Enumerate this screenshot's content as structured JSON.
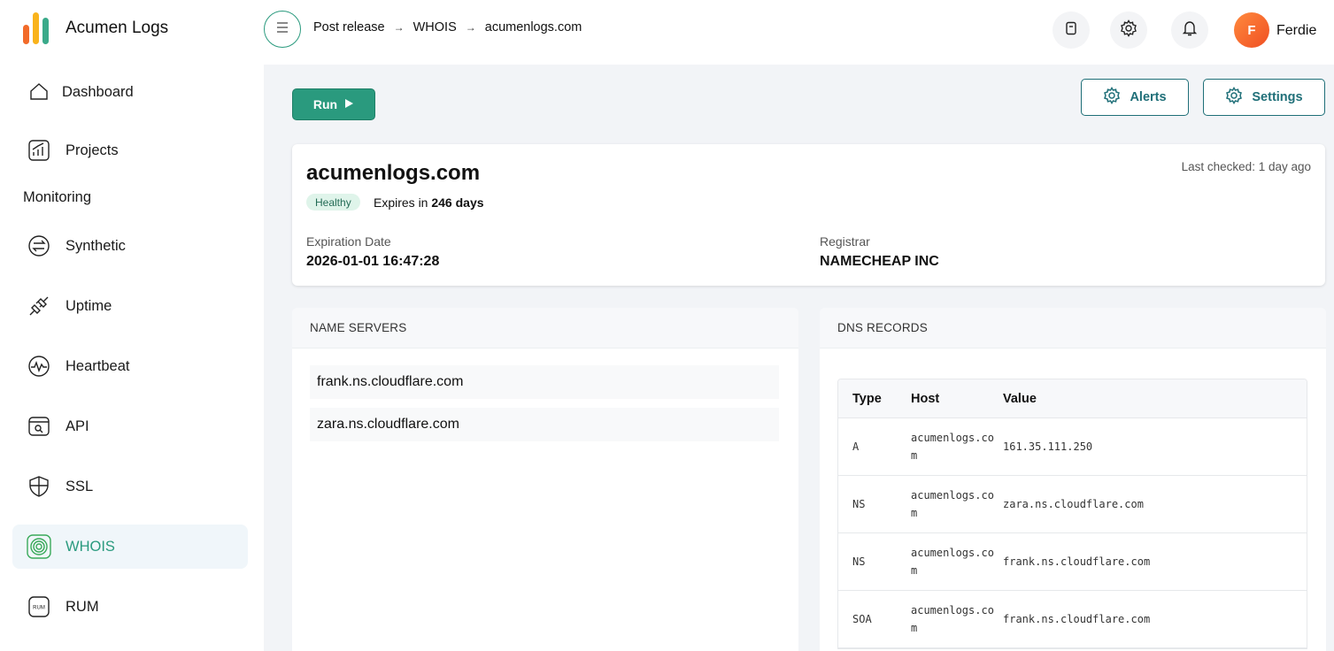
{
  "app": {
    "name": "Acumen Logs",
    "logo_colors": [
      "#f26b2a",
      "#f9b31c",
      "#3aaa8a"
    ]
  },
  "sidebar": {
    "items": [
      {
        "label": "Dashboard",
        "icon": "home-icon"
      },
      {
        "label": "Projects",
        "icon": "chart-icon"
      }
    ],
    "section_title": "Monitoring",
    "monitoring_items": [
      {
        "label": "Synthetic",
        "icon": "synthetic-icon"
      },
      {
        "label": "Uptime",
        "icon": "plug-icon"
      },
      {
        "label": "Heartbeat",
        "icon": "heartbeat-icon"
      },
      {
        "label": "API",
        "icon": "api-icon"
      },
      {
        "label": "SSL",
        "icon": "shield-icon"
      },
      {
        "label": "WHOIS",
        "icon": "whois-icon",
        "active": true
      },
      {
        "label": "RUM",
        "icon": "rum-icon",
        "icon_text": "RUM"
      }
    ]
  },
  "header": {
    "breadcrumb": [
      "Post release",
      "WHOIS",
      "acumenlogs.com"
    ],
    "user": {
      "initial": "F",
      "name": "Ferdie"
    }
  },
  "toolbar": {
    "run_label": "Run",
    "alerts_label": "Alerts",
    "settings_label": "Settings"
  },
  "summary": {
    "domain": "acumenlogs.com",
    "last_checked": "Last checked: 1 day ago",
    "status": "Healthy",
    "expires_prefix": "Expires in ",
    "expires_days": "246 days",
    "expiration_label": "Expiration Date",
    "expiration_value": "2026-01-01 16:47:28",
    "registrar_label": "Registrar",
    "registrar_value": "NAMECHEAP INC"
  },
  "name_servers": {
    "title": "NAME SERVERS",
    "items": [
      "frank.ns.cloudflare.com",
      "zara.ns.cloudflare.com"
    ]
  },
  "dns_records": {
    "title": "DNS RECORDS",
    "columns": [
      "Type",
      "Host",
      "Value"
    ],
    "rows": [
      {
        "type": "A",
        "host": "acumenlogs.com",
        "value": "161.35.111.250"
      },
      {
        "type": "NS",
        "host": "acumenlogs.com",
        "value": "zara.ns.cloudflare.com"
      },
      {
        "type": "NS",
        "host": "acumenlogs.com",
        "value": "frank.ns.cloudflare.com"
      },
      {
        "type": "SOA",
        "host": "acumenlogs.com",
        "value": "frank.ns.cloudflare.com"
      }
    ]
  },
  "colors": {
    "accent": "#2a9a7e",
    "outline": "#1f6f78",
    "healthy_bg": "#dff4ea"
  }
}
